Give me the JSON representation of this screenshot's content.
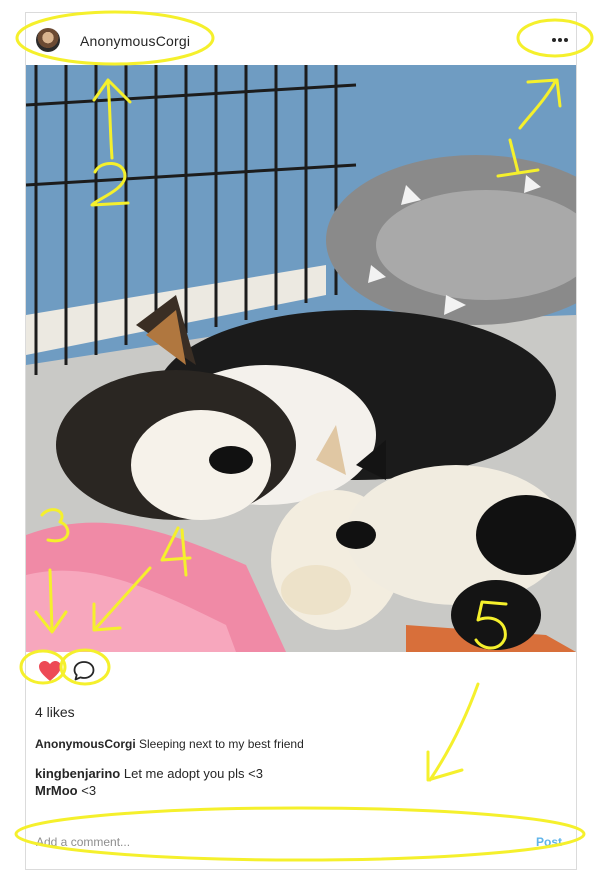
{
  "post": {
    "username": "AnonymousCorgi",
    "more_icon": "more-horizontal-icon",
    "likes_text": "4 likes",
    "caption_user": "AnonymousCorgi",
    "caption_text": "Sleeping next to my best friend",
    "comments": [
      {
        "user": "kingbenjarino",
        "text": "Let me adopt you pls <3"
      },
      {
        "user": "MrMoo",
        "text": "<3"
      }
    ],
    "add_comment_placeholder": "Add a comment...",
    "post_button": "Post"
  },
  "annotations": {
    "color": "#f5f02c",
    "labels": [
      "1",
      "2",
      "3",
      "4",
      "5"
    ]
  },
  "icons": {
    "like": "heart-filled-icon",
    "comment": "comment-bubble-icon"
  },
  "colors": {
    "heart": "#ed4956",
    "link_blue": "#5fb4ea",
    "border": "#dbdbdb"
  }
}
